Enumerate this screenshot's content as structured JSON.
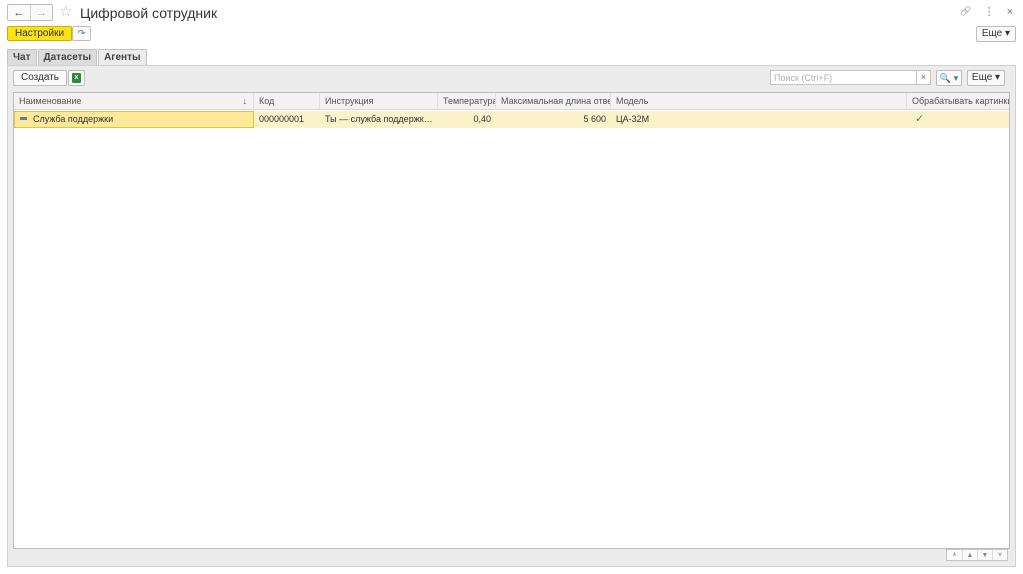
{
  "window": {
    "title": "Цифровой сотрудник",
    "back_icon": "←",
    "forward_icon": "→",
    "favorite_icon": "☆",
    "link_icon": "🔗",
    "menu_icon": "⋮",
    "close_icon": "×"
  },
  "toolbar": {
    "settings_label": "Настройки",
    "small_btn_glyph": "↷",
    "more_label": "Еще ▾"
  },
  "tabs": [
    {
      "label": "Чат",
      "active": false
    },
    {
      "label": "Датасеты",
      "active": false
    },
    {
      "label": "Агенты",
      "active": true
    }
  ],
  "list": {
    "create_label": "Создать",
    "excel_glyph": "x",
    "search_placeholder": "Поиск (Ctrl+F)",
    "search_clear": "×",
    "search_btn": "🔍 ▾",
    "more_label": "Еще ▾",
    "sort_icon": "↓",
    "columns": [
      "Наименование",
      "Код",
      "Инструкция",
      "Температура",
      "Максимальная длина ответа",
      "Модель",
      "Обрабатывать картинки"
    ],
    "rows": [
      {
        "name": "Служба поддержки",
        "code": "000000001",
        "instruction": "Ты — служба поддержки п...",
        "temperature": "0,40",
        "max_length": "5 600",
        "model": "ЦА-32М",
        "process_images": "✓"
      }
    ]
  },
  "pager": [
    "⩚",
    "▲",
    "▼",
    "⩛"
  ],
  "colors": {
    "accent_button": "#fce21b",
    "selected_row": "#fbf2c9",
    "check": "#2e9d2e"
  }
}
